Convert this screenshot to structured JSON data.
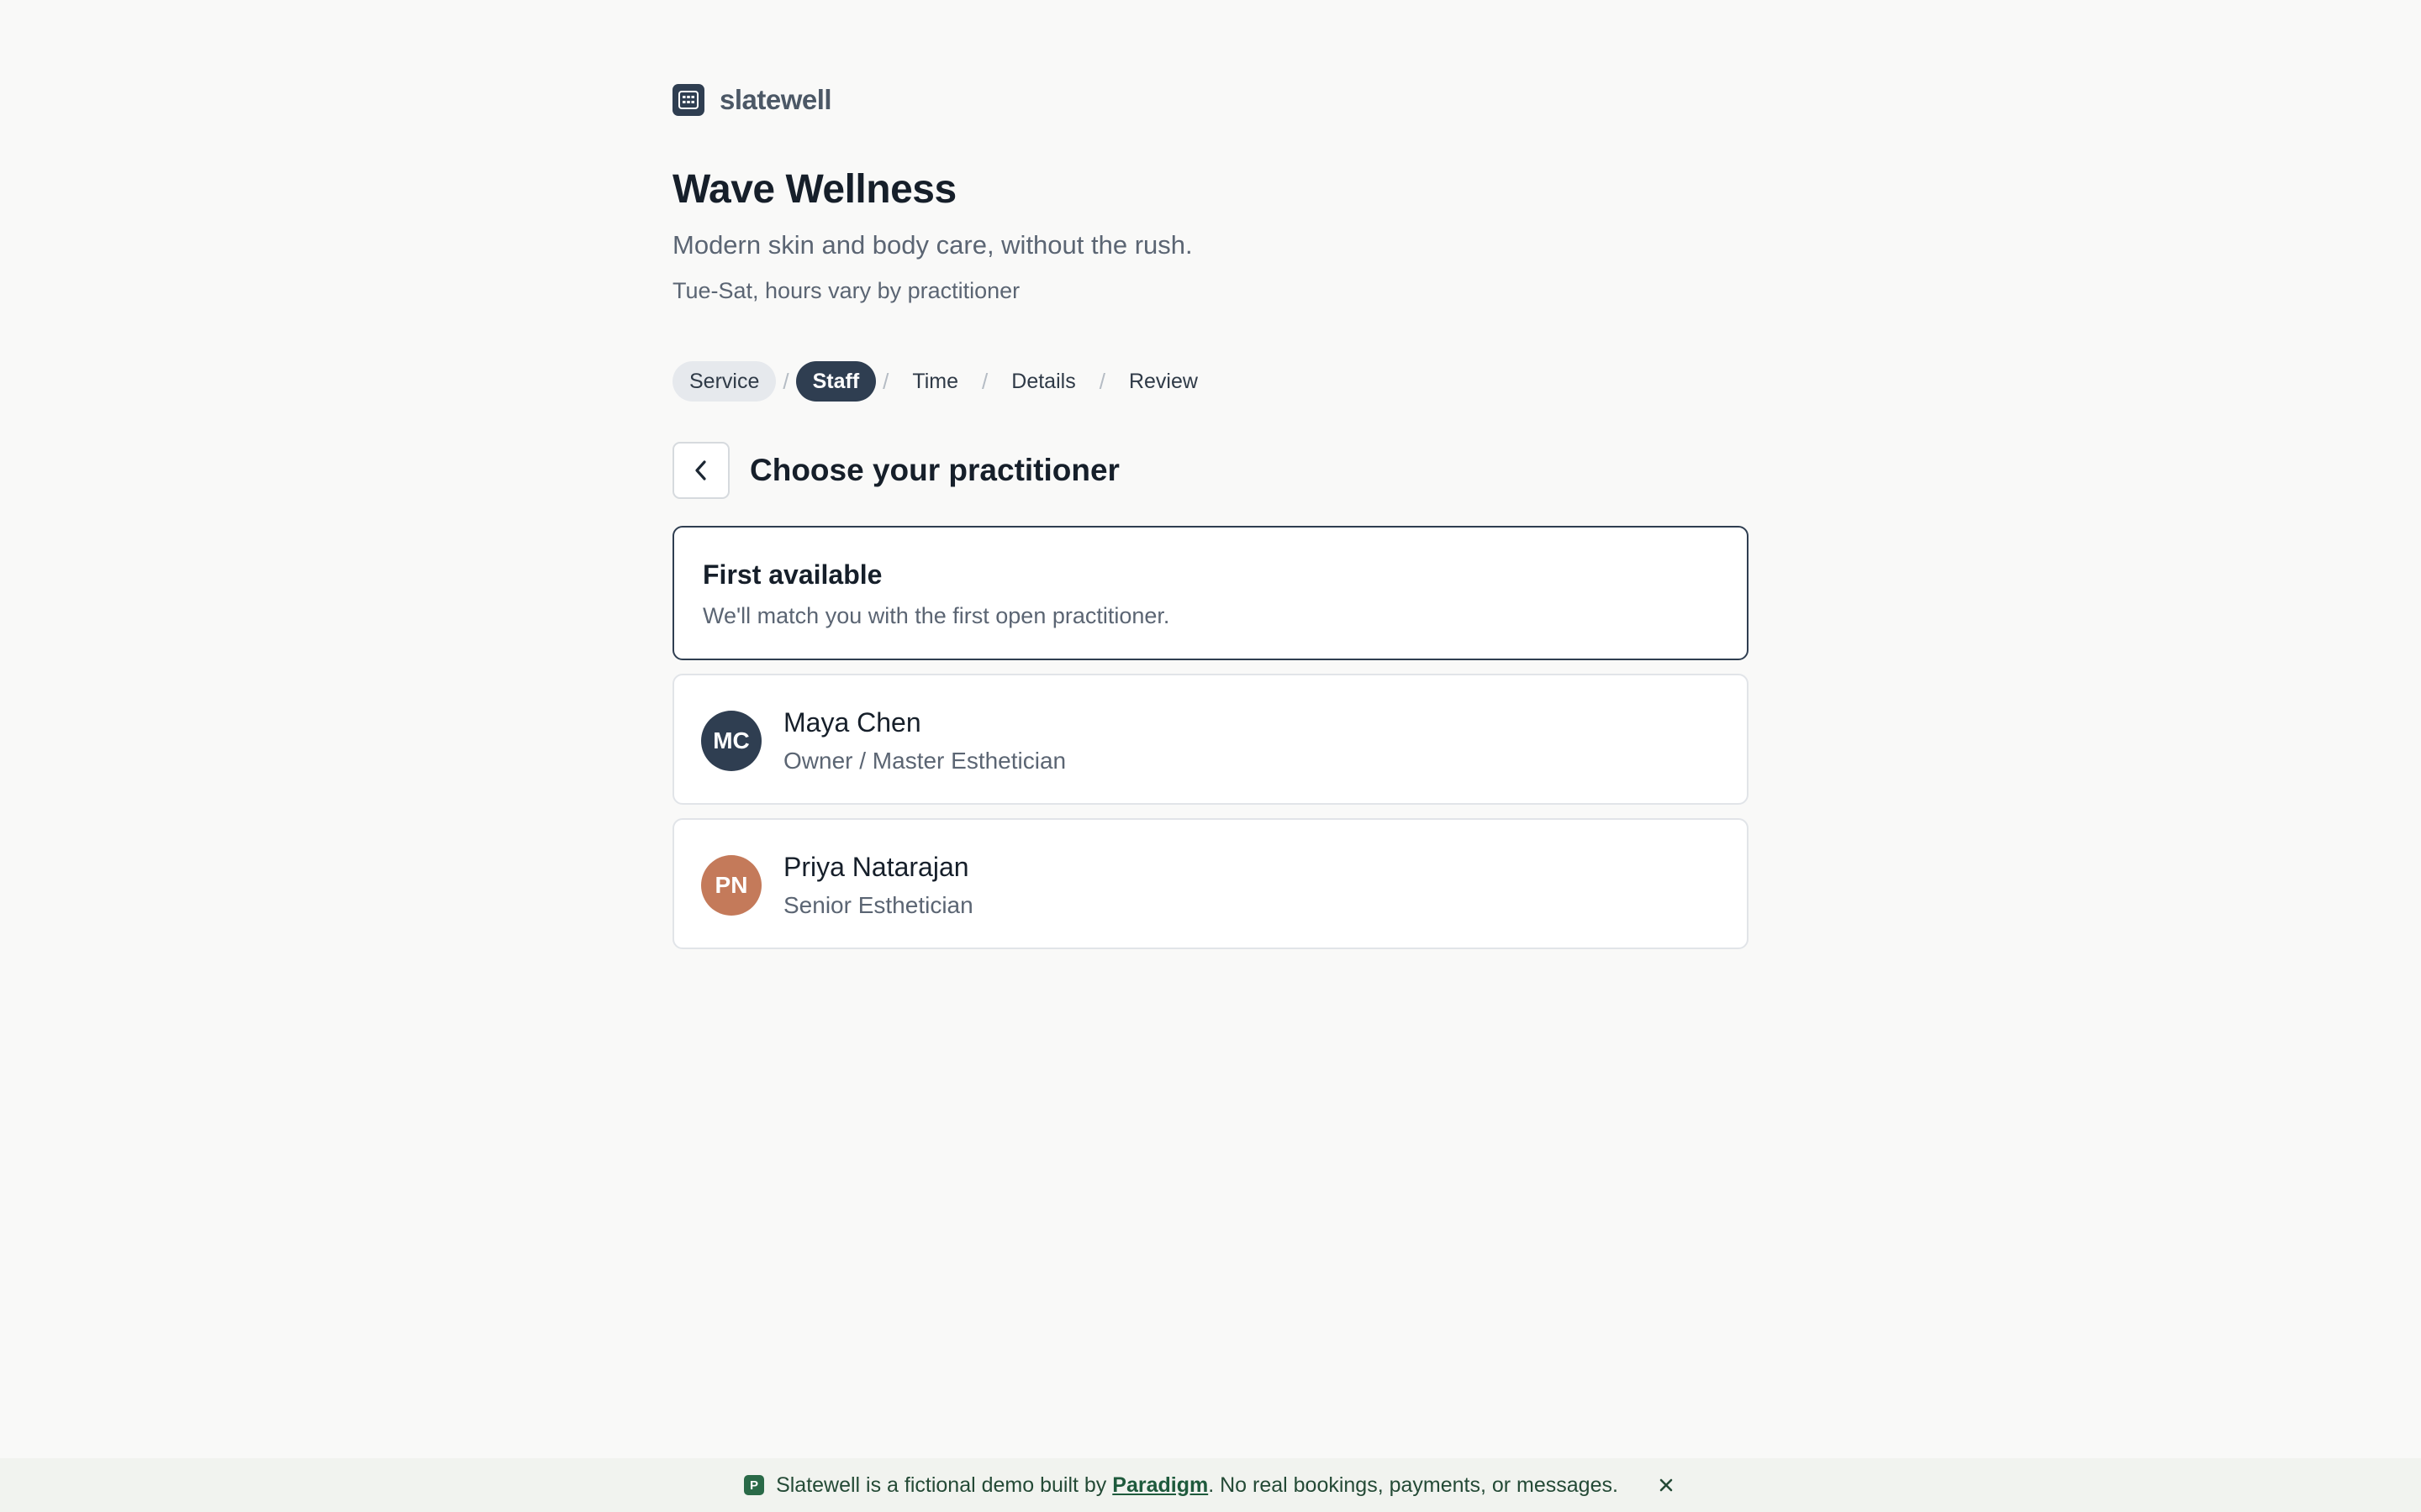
{
  "brand": {
    "name": "slatewell",
    "icon": "calendar-grid-icon"
  },
  "business": {
    "name": "Wave Wellness",
    "tagline": "Modern skin and body care, without the rush.",
    "hours": "Tue-Sat, hours vary by practitioner"
  },
  "stepper": {
    "steps": [
      {
        "label": "Service",
        "state": "done"
      },
      {
        "label": "Staff",
        "state": "active"
      },
      {
        "label": "Time",
        "state": "todo"
      },
      {
        "label": "Details",
        "state": "todo"
      },
      {
        "label": "Review",
        "state": "todo"
      }
    ],
    "separator": "/"
  },
  "section": {
    "title": "Choose your practitioner",
    "back_icon": "chevron-left-icon"
  },
  "first_available": {
    "title": "First available",
    "subtitle": "We'll match you with the first open practitioner."
  },
  "staff": [
    {
      "initials": "MC",
      "name": "Maya Chen",
      "role": "Owner / Master Esthetician",
      "color": "#2f3e51"
    },
    {
      "initials": "PN",
      "name": "Priya Natarajan",
      "role": "Senior Esthetician",
      "color": "#c47a5a"
    }
  ],
  "banner": {
    "text_before": "Slatewell is a fictional demo built by",
    "link": "Paradigm",
    "text_after": ". No real bookings, payments, or messages.",
    "badge": "P",
    "close_icon": "close-icon"
  },
  "colors": {
    "accent": "#2f3e51",
    "banner_green": "#2a6a48"
  }
}
